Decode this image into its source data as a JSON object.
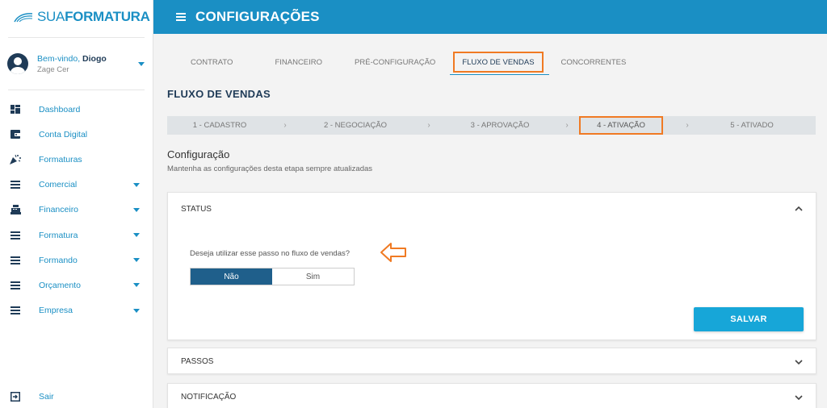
{
  "brand": {
    "name_light": "SUA",
    "name_bold": "FORMATURA",
    "color": "#1a8fc4"
  },
  "user": {
    "welcome_prefix": "Bem-vindo,",
    "name": "Diogo",
    "org": "Zage Cer"
  },
  "sidebar": {
    "items": [
      {
        "label": "Dashboard",
        "icon": "dashboard-icon",
        "has_caret": false
      },
      {
        "label": "Conta Digital",
        "icon": "wallet-icon",
        "has_caret": false
      },
      {
        "label": "Formaturas",
        "icon": "party-icon",
        "has_caret": false
      },
      {
        "label": "Comercial",
        "icon": "menu-lines-icon",
        "has_caret": true
      },
      {
        "label": "Financeiro",
        "icon": "cash-register-icon",
        "has_caret": true
      },
      {
        "label": "Formatura",
        "icon": "menu-lines-icon",
        "has_caret": true
      },
      {
        "label": "Formando",
        "icon": "menu-lines-icon",
        "has_caret": true
      },
      {
        "label": "Orçamento",
        "icon": "menu-lines-icon",
        "has_caret": true
      },
      {
        "label": "Empresa",
        "icon": "menu-lines-icon",
        "has_caret": true
      }
    ],
    "logout_label": "Sair"
  },
  "header": {
    "title": "CONFIGURAÇÕES"
  },
  "tabs": [
    {
      "label": "CONTRATO",
      "active": false
    },
    {
      "label": "FINANCEIRO",
      "active": false
    },
    {
      "label": "PRÉ-CONFIGURAÇÃO",
      "active": false
    },
    {
      "label": "FLUXO DE VENDAS",
      "active": true
    },
    {
      "label": "CONCORRENTES",
      "active": false
    }
  ],
  "section_title": "FLUXO DE VENDAS",
  "stepper": [
    {
      "label": "1 - CADASTRO",
      "active": false
    },
    {
      "label": "2 - NEGOCIAÇÃO",
      "active": false
    },
    {
      "label": "3 - APROVAÇÃO",
      "active": false
    },
    {
      "label": "4 - ATIVAÇÃO",
      "active": true
    },
    {
      "label": "5 - ATIVADO",
      "active": false
    }
  ],
  "stepper_separator": "›",
  "config": {
    "title": "Configuração",
    "subtitle": "Mantenha as configurações desta etapa sempre atualizadas"
  },
  "status_panel": {
    "title": "STATUS",
    "question": "Deseja utilizar esse passo no fluxo de vendas?",
    "option_no": "Não",
    "option_yes": "Sim",
    "selected": "Não",
    "save_label": "SALVAR"
  },
  "passos_panel": {
    "title": "PASSOS"
  },
  "notificacao_panel": {
    "title": "NOTIFICAÇÃO"
  },
  "colors": {
    "highlight": "#f07a23",
    "primary": "#1a8fc4",
    "toggle_selected": "#1f5f8b"
  }
}
